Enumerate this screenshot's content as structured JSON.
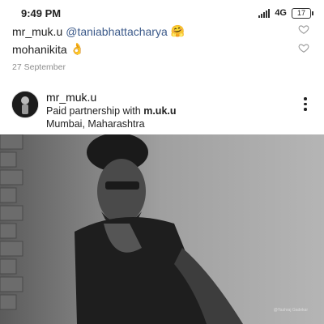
{
  "status_bar": {
    "time": "9:49 PM",
    "network": "4G",
    "battery": "17"
  },
  "comments": [
    {
      "user": "mr_muk.u",
      "mention": "@taniabhattacharya",
      "emoji": "🤗"
    },
    {
      "user": "mohanikita",
      "emoji": "👌"
    }
  ],
  "date": "27 September",
  "post": {
    "username": "mr_muk.u",
    "paid_prefix": "Paid partnership with",
    "partner": "m.uk.u",
    "location": "Mumbai, Maharashtra",
    "photo_credit": "@Yashraj Gadekar"
  },
  "icons": {
    "heart": "heart-outline-icon",
    "more": "more-vertical-icon"
  }
}
